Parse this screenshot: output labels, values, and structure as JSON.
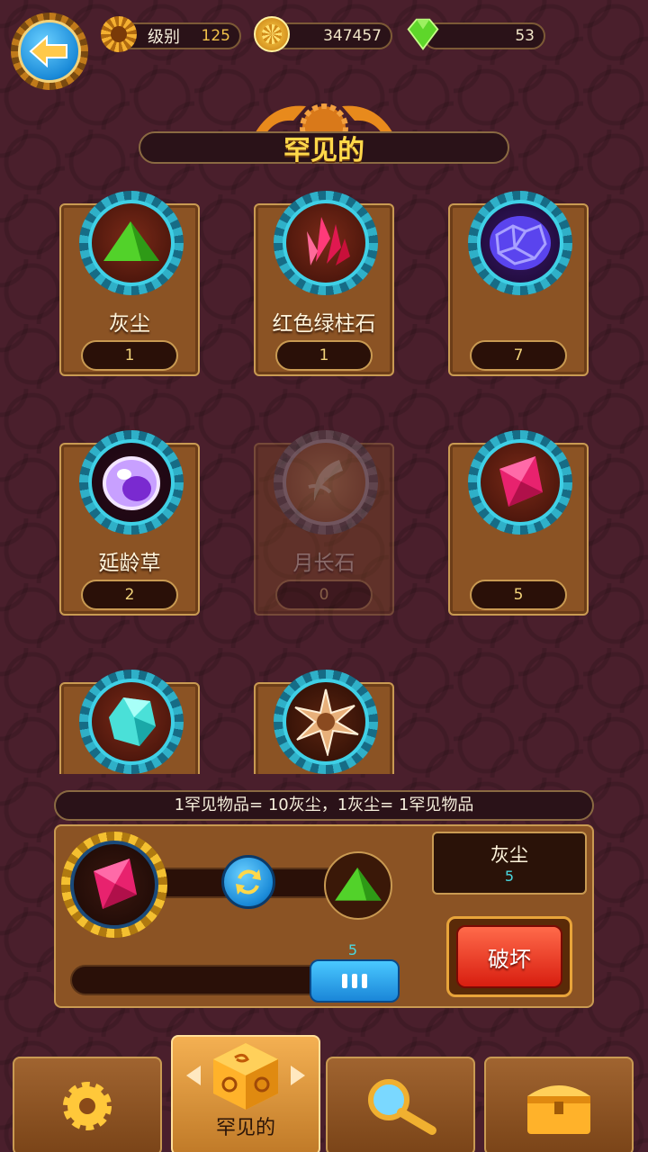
{
  "header": {
    "level_label": "级别",
    "level_value": "125",
    "coins": "347457",
    "gems": "53"
  },
  "title": "罕见的",
  "items": [
    {
      "name": "灰尘",
      "count": "1",
      "icon": "green-dust-icon"
    },
    {
      "name": "红色绿柱石",
      "count": "1",
      "icon": "red-crystal-icon"
    },
    {
      "name": "",
      "count": "7",
      "icon": "blue-ore-icon"
    },
    {
      "name": "延龄草",
      "count": "2",
      "icon": "purple-orb-icon"
    },
    {
      "name": "月长石",
      "count": "0",
      "icon": "moonstone-icon"
    },
    {
      "name": "",
      "count": "5",
      "icon": "pink-gem-icon"
    },
    {
      "name": "",
      "count": "",
      "icon": "cyan-crystal-icon"
    },
    {
      "name": "",
      "count": "",
      "icon": "spiky-seed-icon"
    }
  ],
  "conversion_text": "1罕见物品= 10灰尘，1灰尘= 1罕见物品",
  "result": {
    "name": "灰尘",
    "amount": "5"
  },
  "slider_value": "5",
  "destroy_label": "破坏",
  "tabs": {
    "rare_label": "罕见的"
  },
  "colors": {
    "accent_gold": "#ffd84a",
    "destroy_red": "#e8321e",
    "teal_gear": "#2fb0c8"
  }
}
